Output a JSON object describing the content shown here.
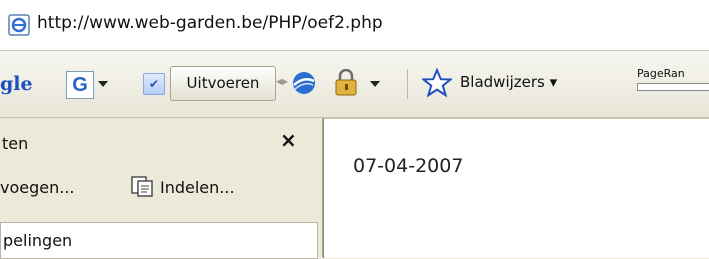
{
  "address": {
    "url": "http://www.web-garden.be/PHP/oef2.php"
  },
  "toolbar": {
    "google_logo_text": "gle",
    "google_box_letter": "G",
    "run_button": "Uitvoeren",
    "bookmarks": "Bladwijzers",
    "pagerank": "PageRan"
  },
  "sidebar": {
    "title": "ten",
    "close": "×",
    "add_button": "voegen...",
    "organize_button": "Indelen...",
    "list_item": "pelingen"
  },
  "content": {
    "date": "07-04-2007"
  },
  "icons": [
    "ie-page-icon",
    "google-g-icon",
    "checkbox-icon",
    "globe-icon",
    "lock-icon",
    "star-icon",
    "organize-icon",
    "close-icon"
  ]
}
